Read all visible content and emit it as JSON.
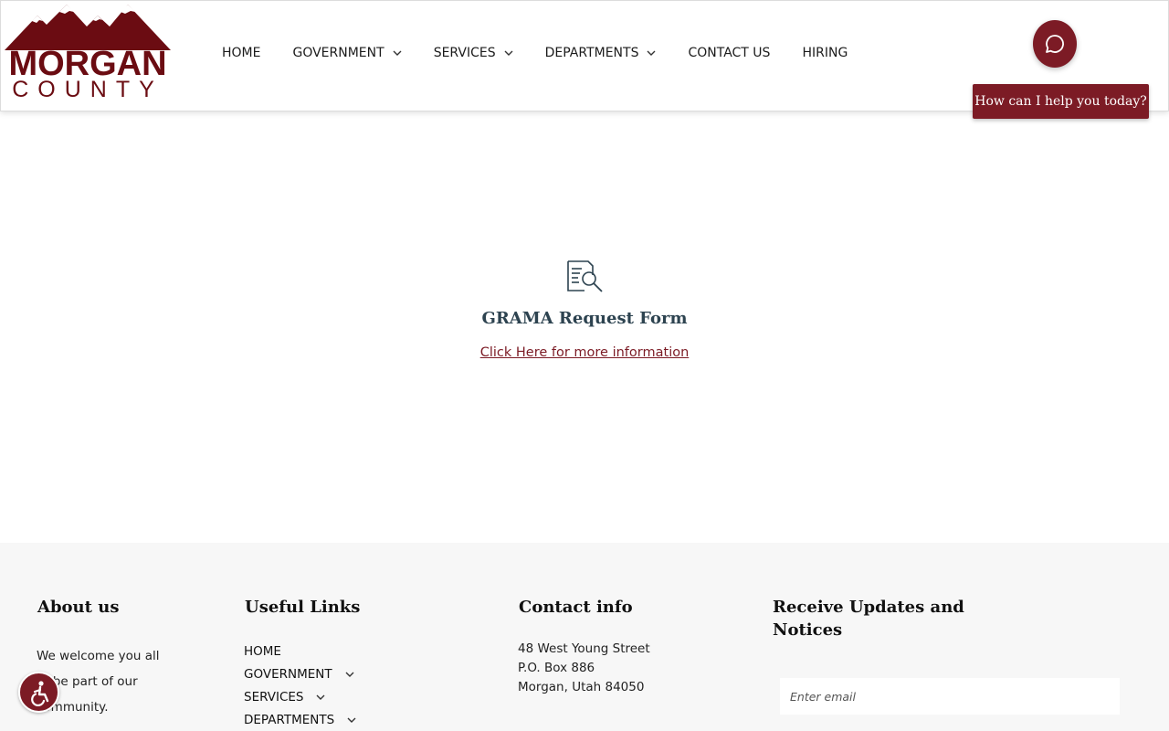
{
  "header": {
    "logo": {
      "line1": "MORGAN",
      "line2": "COUNTY",
      "color": "#6b0c12"
    },
    "nav": [
      {
        "label": "HOME",
        "dropdown": false
      },
      {
        "label": "GOVERNMENT",
        "dropdown": true
      },
      {
        "label": "SERVICES",
        "dropdown": true
      },
      {
        "label": "DEPARTMENTS",
        "dropdown": true
      },
      {
        "label": "CONTACT US",
        "dropdown": false
      },
      {
        "label": "HIRING",
        "dropdown": false
      }
    ]
  },
  "chat": {
    "icon": "chat-bubble-icon",
    "prompt": "How can I help you today?",
    "color": "#7c1b25"
  },
  "main": {
    "icon": "document-search-icon",
    "title": "GRAMA Request Form",
    "link_text": "Click Here for more information"
  },
  "footer": {
    "about": {
      "heading": "About us",
      "text": "We welcome you all to be part of our community."
    },
    "links": {
      "heading": "Useful Links",
      "items": [
        {
          "label": "HOME",
          "dropdown": false
        },
        {
          "label": "GOVERNMENT",
          "dropdown": true
        },
        {
          "label": "SERVICES",
          "dropdown": true
        },
        {
          "label": "DEPARTMENTS",
          "dropdown": true
        }
      ]
    },
    "contact": {
      "heading": "Contact info",
      "address_line1": "48 West Young Street",
      "address_line2": "P.O. Box 886",
      "address_line3": "Morgan, Utah 84050"
    },
    "updates": {
      "heading": "Receive Updates and Notices",
      "email_placeholder": "Enter email"
    }
  },
  "accessibility": {
    "icon": "accessibility-icon"
  }
}
